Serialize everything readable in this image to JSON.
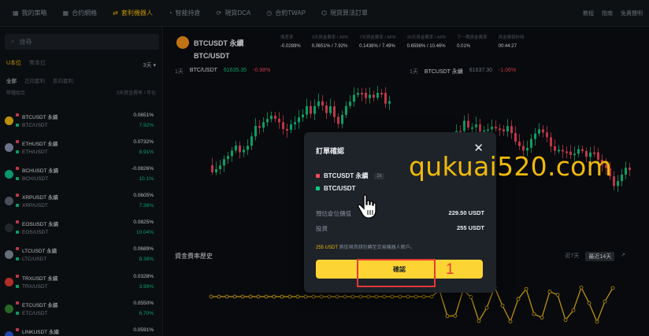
{
  "nav": {
    "tabs": [
      {
        "icon": "grid-icon",
        "label": "我的策略"
      },
      {
        "icon": "grid-icon",
        "label": "合约網格"
      },
      {
        "icon": "arbitrage-icon",
        "label": "套利機器人"
      },
      {
        "icon": "rebalance-icon",
        "label": "智能持倉"
      },
      {
        "icon": "dca-icon",
        "label": "現貨DCA"
      },
      {
        "icon": "twap-icon",
        "label": "合約TWAP"
      },
      {
        "icon": "algo-icon",
        "label": "現貨算法訂單"
      }
    ],
    "right": [
      "教程",
      "指南",
      "免責聲明"
    ]
  },
  "sidebar": {
    "search_placeholder": "搜尋",
    "subtabs": [
      "U本位",
      "幣本位"
    ],
    "sort_value": "3天",
    "filters": [
      "全部",
      "正向套利",
      "反向套利"
    ],
    "col_left": "幣種組合",
    "col_right": "3天資金費率 / 年化",
    "pairs": [
      {
        "perp": "BTCUSDT 永續",
        "spot": "BTC/USDT",
        "rate": "0.0651%",
        "apr": "7.92%",
        "color": "#f0b90b"
      },
      {
        "perp": "ETHUSDT 永續",
        "spot": "ETH/USDT",
        "rate": "0.0732%",
        "apr": "8.91%",
        "color": "#8a92b2"
      },
      {
        "perp": "BCHUSDT 永續",
        "spot": "BCH/USDT",
        "rate": "-0.0826%",
        "apr": "10.1%",
        "color": "#0ac18e"
      },
      {
        "perp": "XRPUSDT 永續",
        "spot": "XRP/USDT",
        "rate": "0.0605%",
        "apr": "7.36%",
        "color": "#5e6673"
      },
      {
        "perp": "EOSUSDT 永續",
        "spot": "EOS/USDT",
        "rate": "0.0825%",
        "apr": "10.04%",
        "color": "#2b3139"
      },
      {
        "perp": "LTCUSDT 永續",
        "spot": "LTC/USDT",
        "rate": "0.0689%",
        "apr": "8.38%",
        "color": "#848e9c"
      },
      {
        "perp": "TRXUSDT 永續",
        "spot": "TRX/USDT",
        "rate": "0.0328%",
        "apr": "3.99%",
        "color": "#e53935"
      },
      {
        "perp": "ETCUSDT 永續",
        "spot": "ETC/USDT",
        "rate": "0.0550%",
        "apr": "6.70%",
        "color": "#328332"
      },
      {
        "perp": "LINKUSDT 永續",
        "spot": "",
        "rate": "0.0591%",
        "apr": "",
        "color": "#2a5ada"
      }
    ]
  },
  "header": {
    "perp": "BTCUSDT 永續",
    "spot": "BTC/USDT",
    "stats": [
      {
        "k": "價差率",
        "v": "-0.0289%"
      },
      {
        "k": "3天資金費率 / APR",
        "v": "0.0651% / 7.92%"
      },
      {
        "k": "7天資金費率 / APR",
        "v": "0.1438% / 7.49%"
      },
      {
        "k": "30天資金費率 / APR",
        "v": "0.6598% / 10.46%"
      },
      {
        "k": "下一期資金費率",
        "v": "0.01%"
      },
      {
        "k": "資金費倒計時",
        "v": "00:44:27"
      }
    ]
  },
  "charts": {
    "left": {
      "interval": "1天",
      "pair": "BTC/USDT",
      "price": "61635.35",
      "change": "-0.98%"
    },
    "right": {
      "interval": "1天",
      "pair": "BTCUSDT 永續",
      "price": "61637.30",
      "change": "-1.06%"
    }
  },
  "history": {
    "title": "資金費率歷史",
    "ctl_left": "近7天",
    "ctl_selected": "最近14天"
  },
  "dialog": {
    "title": "訂單確認",
    "perp": "BTCUSDT 永續",
    "leverage": "2x",
    "spot": "BTC/USDT",
    "rows": [
      {
        "k": "預估倉位價值",
        "v": "229.50 USDT"
      },
      {
        "k": "投資",
        "v": "255 USDT"
      }
    ],
    "note_amount": "255 USDT",
    "note_text": "將從現貨錢包轉至交易機器人賬戶。",
    "confirm_label": "確認",
    "annotation_number": "1"
  },
  "watermark": "qukuai520.com"
}
